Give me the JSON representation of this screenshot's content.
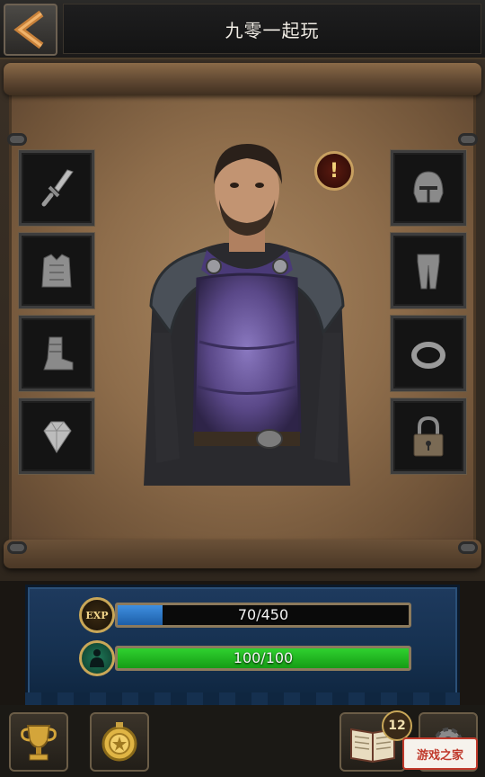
{
  "header": {
    "title": "九零一起玩"
  },
  "equipment": {
    "left_slots": [
      {
        "icon": "sword-icon"
      },
      {
        "icon": "chest-armor-icon"
      },
      {
        "icon": "boots-icon"
      },
      {
        "icon": "gem-icon"
      }
    ],
    "right_slots": [
      {
        "icon": "helmet-icon"
      },
      {
        "icon": "leg-armor-icon"
      },
      {
        "icon": "ring-icon"
      },
      {
        "icon": "padlock-icon"
      }
    ],
    "alert_symbol": "!"
  },
  "stats": {
    "exp": {
      "icon_label": "EXP",
      "text": "70/450",
      "current": 70,
      "max": 450,
      "color": "#3f8fe0"
    },
    "health": {
      "text": "100/100",
      "current": 100,
      "max": 100,
      "color": "#2fd12f"
    }
  },
  "bottom_bar": {
    "book_badge": "12"
  },
  "watermark": {
    "text": "游戏之家"
  }
}
